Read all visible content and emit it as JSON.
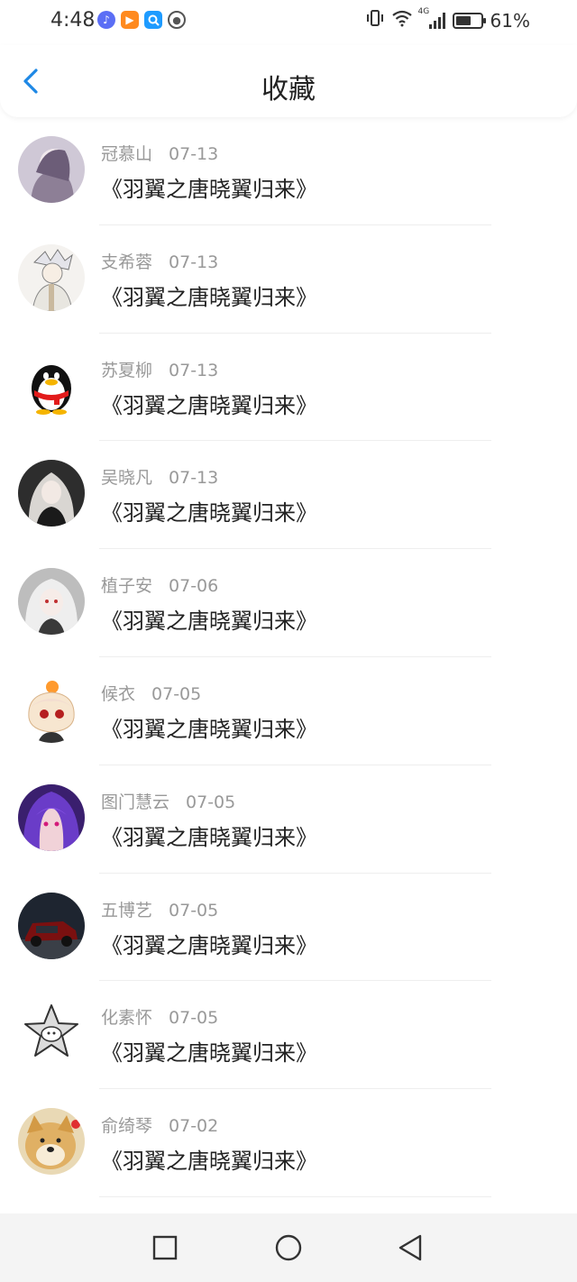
{
  "status_bar": {
    "time": "4:48",
    "net_label": "4G",
    "battery_text": "61%",
    "battery_level": 0.61,
    "app_icons": [
      "music-app-icon",
      "video-app-icon",
      "search-app-icon",
      "browser-app-icon"
    ]
  },
  "header": {
    "back_icon": "chevron-left-icon",
    "title": "收藏",
    "accent_color": "#1e88e5"
  },
  "favorites": [
    {
      "user": "冠慕山",
      "date": "07-13",
      "title": "《羽翼之唐晓翼归来》",
      "avatar": "anime-girl-avatar"
    },
    {
      "user": "支希蓉",
      "date": "07-13",
      "title": "《羽翼之唐晓翼归来》",
      "avatar": "anime-samurai-avatar"
    },
    {
      "user": "苏夏柳",
      "date": "07-13",
      "title": "《羽翼之唐晓翼归来》",
      "avatar": "qq-penguin-avatar"
    },
    {
      "user": "吴晓凡",
      "date": "07-13",
      "title": "《羽翼之唐晓翼归来》",
      "avatar": "gothic-girl-avatar"
    },
    {
      "user": "植子安",
      "date": "07-06",
      "title": "《羽翼之唐晓翼归来》",
      "avatar": "white-hair-girl-avatar"
    },
    {
      "user": "候衣",
      "date": "07-05",
      "title": "《羽翼之唐晓翼归来》",
      "avatar": "chibi-girl-avatar"
    },
    {
      "user": "图门慧云",
      "date": "07-05",
      "title": "《羽翼之唐晓翼归来》",
      "avatar": "purple-hair-avatar"
    },
    {
      "user": "五博艺",
      "date": "07-05",
      "title": "《羽翼之唐晓翼归来》",
      "avatar": "car-avatar"
    },
    {
      "user": "化素怀",
      "date": "07-05",
      "title": "《羽翼之唐晓翼归来》",
      "avatar": "star-sheep-avatar"
    },
    {
      "user": "俞绮琴",
      "date": "07-02",
      "title": "《羽翼之唐晓翼归来》",
      "avatar": "doge-avatar"
    }
  ],
  "nav_bar": {
    "recent_icon": "square-icon",
    "home_icon": "circle-icon",
    "back_icon": "triangle-back-icon"
  }
}
